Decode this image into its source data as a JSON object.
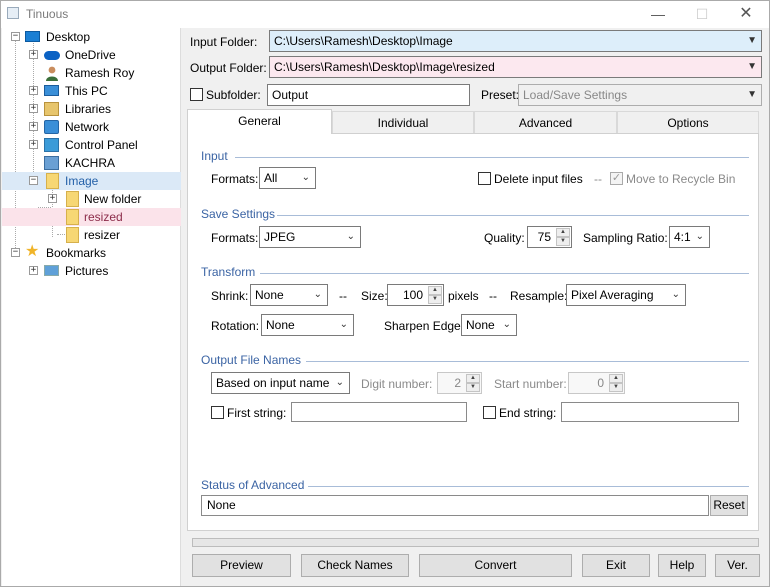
{
  "window": {
    "title": "Tinuous",
    "min": "—",
    "max": "☐",
    "close": "✕"
  },
  "tree": {
    "nodes": [
      {
        "label": "Desktop",
        "icon": "desktop-icon"
      },
      {
        "label": "OneDrive",
        "icon": "onedrive-icon"
      },
      {
        "label": "Ramesh Roy",
        "icon": "user-icon"
      },
      {
        "label": "This PC",
        "icon": "computer-icon"
      },
      {
        "label": "Libraries",
        "icon": "libraries-icon"
      },
      {
        "label": "Network",
        "icon": "network-icon"
      },
      {
        "label": "Control Panel",
        "icon": "control-panel-icon"
      },
      {
        "label": "KACHRA",
        "icon": "kachra-icon"
      },
      {
        "label": "Image",
        "icon": "folder-icon"
      },
      {
        "label": "New folder",
        "icon": "folder-icon"
      },
      {
        "label": "resized",
        "icon": "folder-icon"
      },
      {
        "label": "resizer",
        "icon": "folder-icon"
      },
      {
        "label": "Bookmarks",
        "icon": "star-icon"
      },
      {
        "label": "Pictures",
        "icon": "pictures-icon"
      }
    ]
  },
  "top": {
    "input_label": "Input Folder:",
    "input_value": "C:\\Users\\Ramesh\\Desktop\\Image",
    "output_label": "Output Folder:",
    "output_value": "C:\\Users\\Ramesh\\Desktop\\Image\\resized",
    "subfolder_label": "Subfolder:",
    "subfolder_checked": false,
    "subfolder_value": "Output",
    "preset_label": "Preset:",
    "preset_placeholder": "Load/Save Settings"
  },
  "tabs": [
    "General",
    "Individual",
    "Advanced",
    "Options"
  ],
  "general": {
    "input_section": "Input",
    "formats_label": "Formats:",
    "input_format": "All",
    "delete_input_label": "Delete input files",
    "delete_input_checked": false,
    "dashes": "--",
    "recycle_label": "Move to Recycle Bin",
    "recycle_checked": true,
    "save_section": "Save Settings",
    "save_format": "JPEG",
    "quality_label": "Quality:",
    "quality": "75",
    "sampling_label": "Sampling Ratio:",
    "sampling": "4:1",
    "transform_section": "Transform",
    "shrink_label": "Shrink:",
    "shrink": "None",
    "size_label": "Size:",
    "size": "100",
    "pixels_label": "pixels",
    "resample_label": "Resample:",
    "resample": "Pixel Averaging",
    "rotation_label": "Rotation:",
    "rotation": "None",
    "sharpen_label": "Sharpen Edge:",
    "sharpen": "None",
    "names_section": "Output File Names",
    "naming": "Based on input name",
    "digit_label": "Digit number:",
    "digit": "2",
    "start_label": "Start number:",
    "start": "0",
    "first_label": "First string:",
    "end_label": "End string:",
    "status_section": "Status of Advanced",
    "status_value": "None",
    "reset_label": "Reset"
  },
  "buttons": {
    "preview": "Preview",
    "check": "Check Names",
    "convert": "Convert",
    "exit": "Exit",
    "help": "Help",
    "ver": "Ver."
  }
}
